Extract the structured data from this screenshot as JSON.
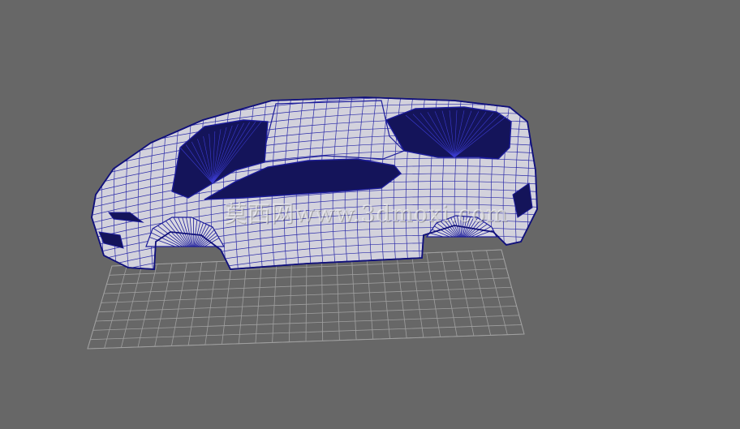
{
  "viewport": {
    "background_color": "#676767",
    "grid_color": "#a0a0a0",
    "wire_color": "#1c1c9a",
    "surface_color": "#d3d2dc",
    "interior_color": "#14145a"
  },
  "scene": {
    "object": "car-wireframe-model",
    "watermark_text": "莫西网www.3dmoxi.com"
  }
}
